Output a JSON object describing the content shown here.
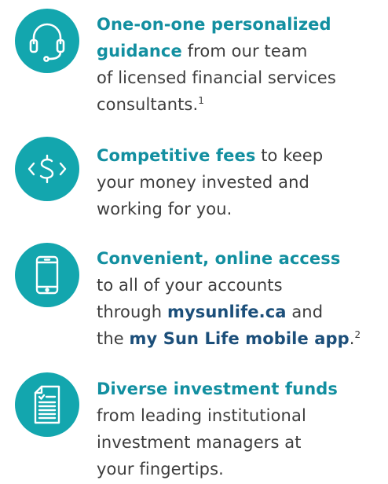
{
  "features": [
    {
      "icon": "headset-icon",
      "highlight_line1": "One-on-one personalized",
      "highlight_line2": "guidance",
      "text_line2": " from our team",
      "text_line3": "of licensed financial services",
      "text_line4": "consultants.",
      "footnote": "1"
    },
    {
      "icon": "dollar-code-icon",
      "highlight": "Competitive fees",
      "text_line1": " to keep",
      "text_line2": "your money invested and",
      "text_line3": "working for you."
    },
    {
      "icon": "smartphone-icon",
      "highlight": "Convenient, online access",
      "text_line2": "to all of your accounts",
      "text_line3_pre": "through ",
      "link1": "mysunlife.ca",
      "text_line3_post": " and",
      "text_line4_pre": "the ",
      "link2": "my Sun Life mobile app",
      "text_line4_post": ".",
      "footnote": "2"
    },
    {
      "icon": "document-checklist-icon",
      "highlight": "Diverse investment funds",
      "text_line2": "from leading institutional",
      "text_line3": "investment managers at",
      "text_line4": "your fingertips."
    }
  ],
  "colors": {
    "icon_circle": "#13a6ae",
    "highlight_text": "#128fa0",
    "link_text": "#1c4f7a",
    "body_text": "#3d3d3d"
  }
}
